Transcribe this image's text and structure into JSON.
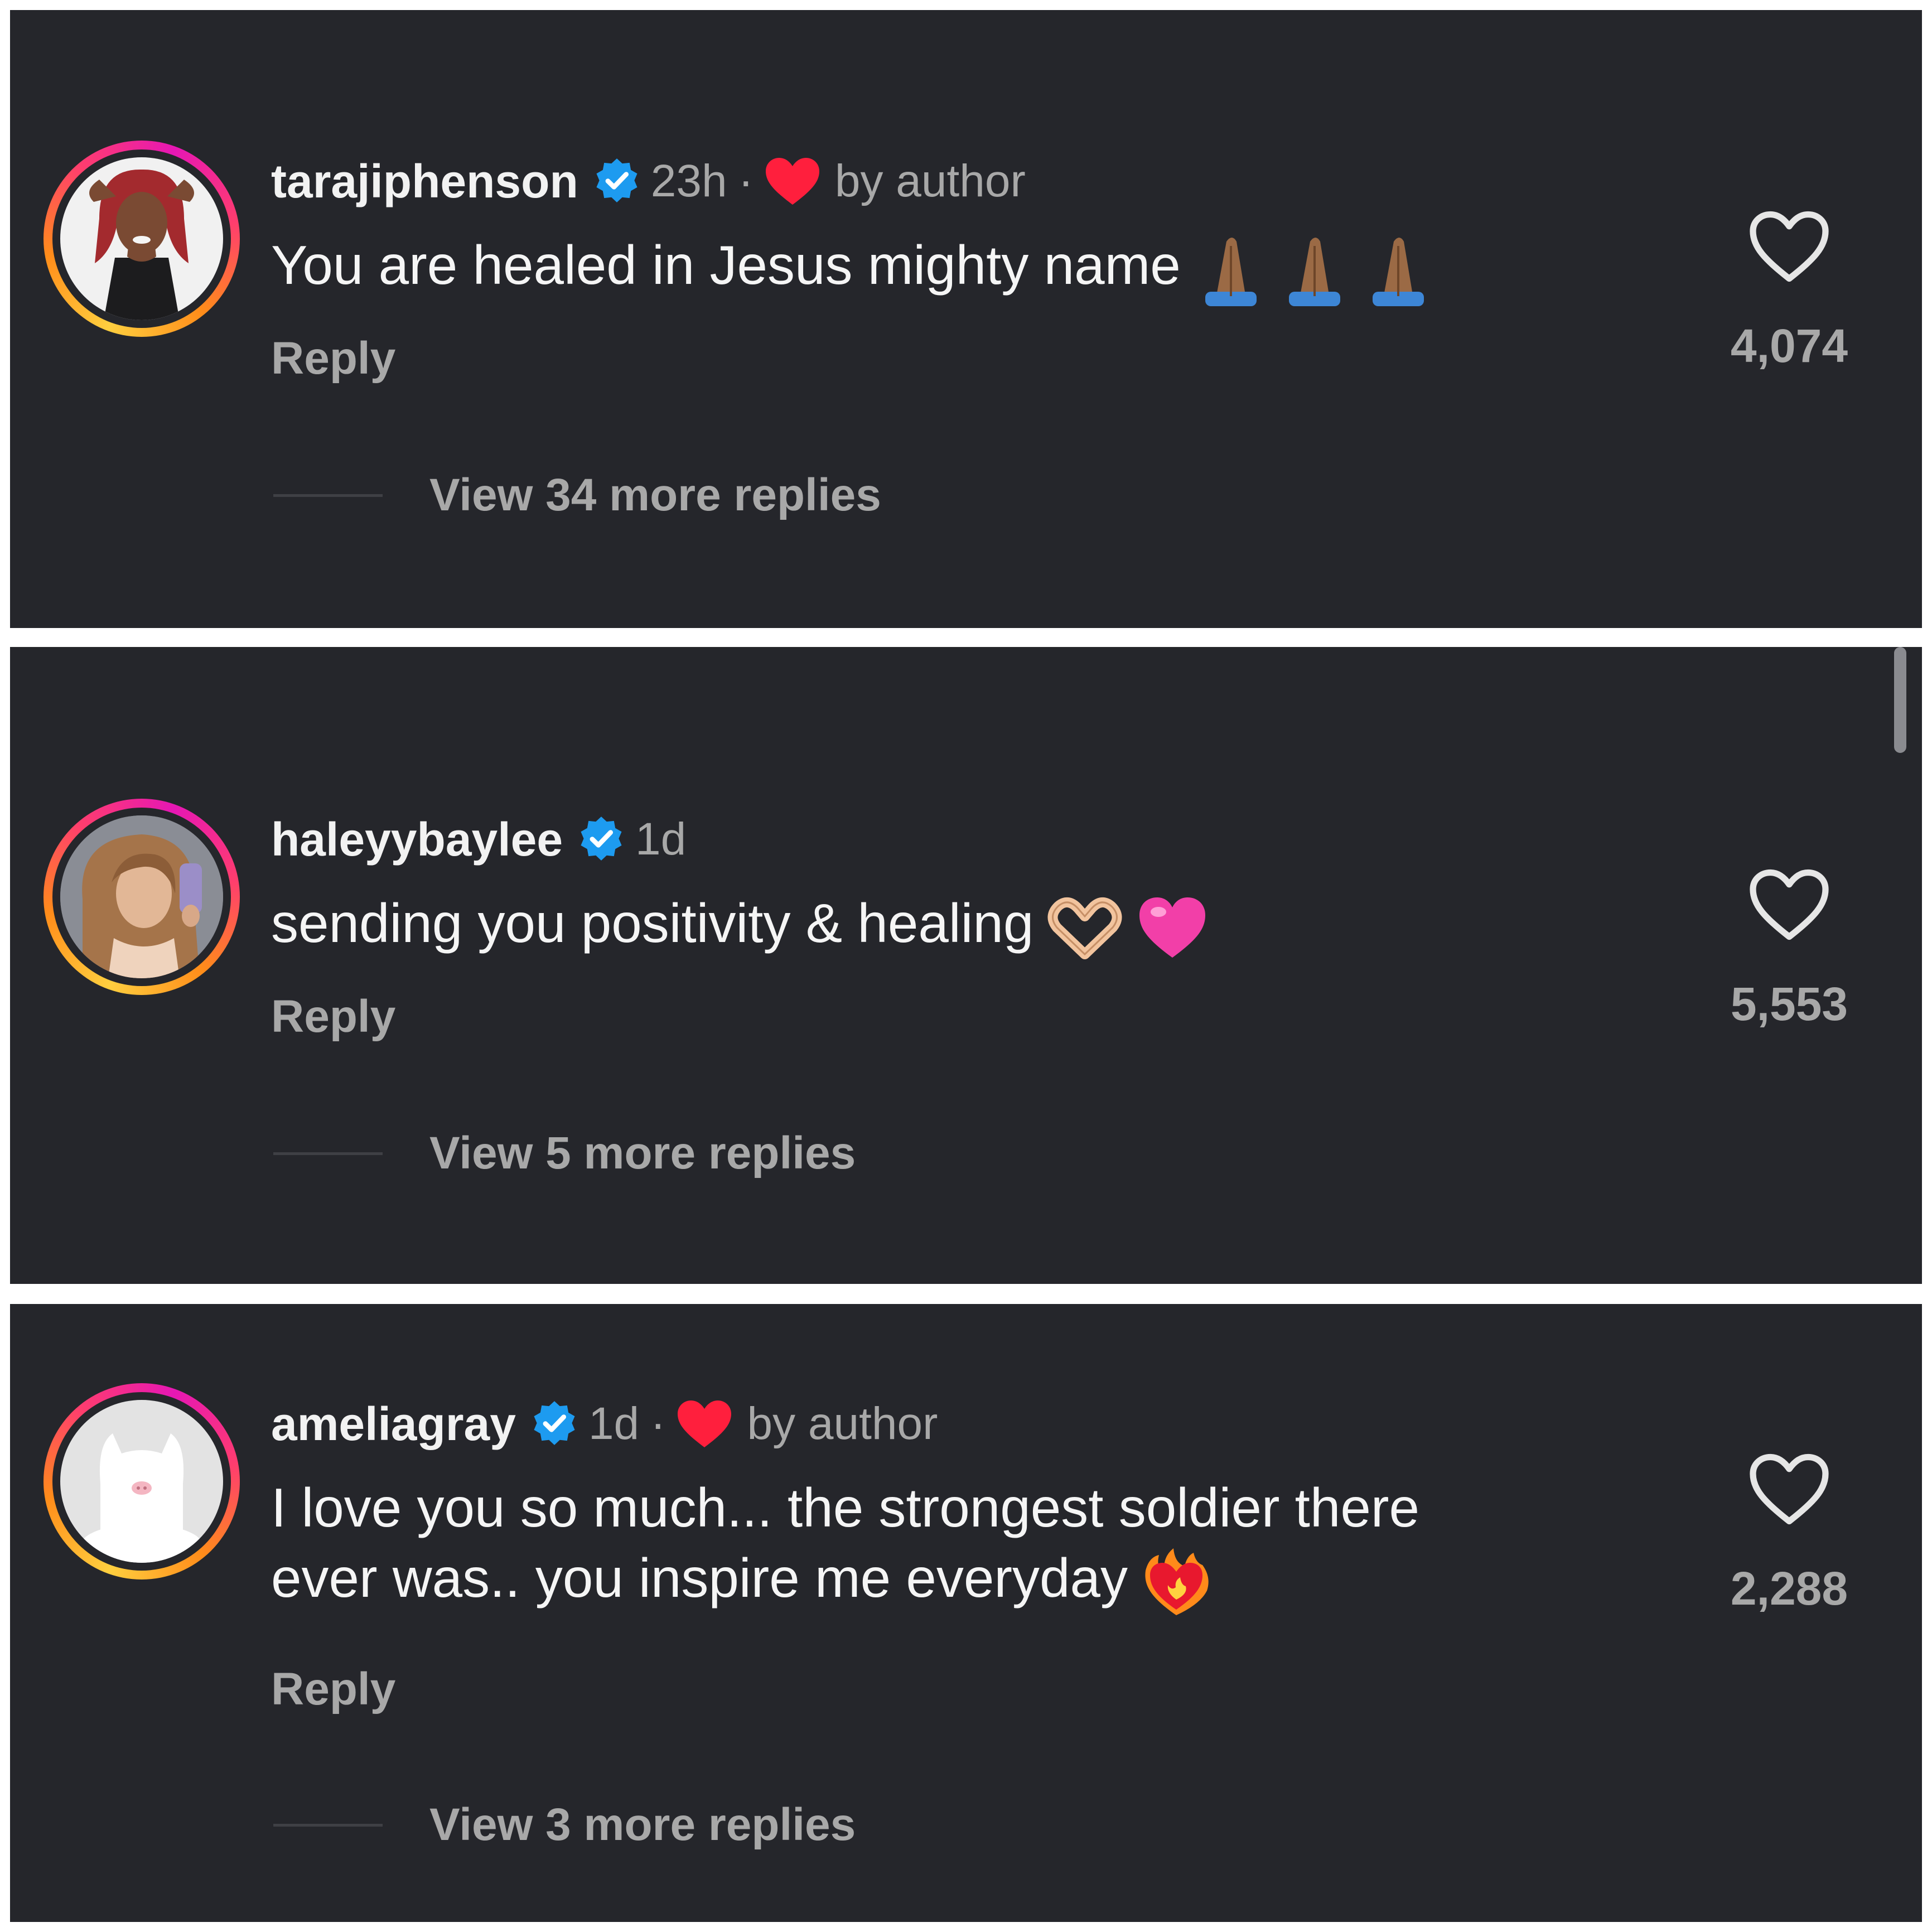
{
  "comments": [
    {
      "username": "tarajiphenson",
      "verified": true,
      "time": "23h",
      "separator": "·",
      "liked_by_author": true,
      "by_author_label": "by author",
      "text": "You are healed in Jesus mighty name",
      "emojis": [
        "folded-hands-medium-dark",
        "folded-hands-medium-dark",
        "folded-hands-medium-dark"
      ],
      "reply_label": "Reply",
      "view_replies_label": "View 34 more replies",
      "like_count": "4,074"
    },
    {
      "username": "haleyybaylee",
      "verified": true,
      "time": "1d",
      "liked_by_author": false,
      "text": "sending you positivity & healing",
      "emojis": [
        "heart-hands-light",
        "pink-heart"
      ],
      "reply_label": "Reply",
      "view_replies_label": "View 5 more replies",
      "like_count": "5,553"
    },
    {
      "username": "ameliagray",
      "verified": true,
      "time": "1d",
      "separator": "·",
      "liked_by_author": true,
      "by_author_label": "by author",
      "text": "I love you so much... the strongest soldier there\never was.. you inspire me everyday",
      "emojis": [
        "heart-on-fire"
      ],
      "reply_label": "Reply",
      "view_replies_label": "View 3 more replies",
      "like_count": "2,288"
    }
  ],
  "colors": {
    "background": "#25262b",
    "verified_blue": "#1d9bf0",
    "author_heart_red": "#ff1f3d",
    "secondary_text": "#a8a8a8",
    "primary_text": "#f5f5f5"
  }
}
